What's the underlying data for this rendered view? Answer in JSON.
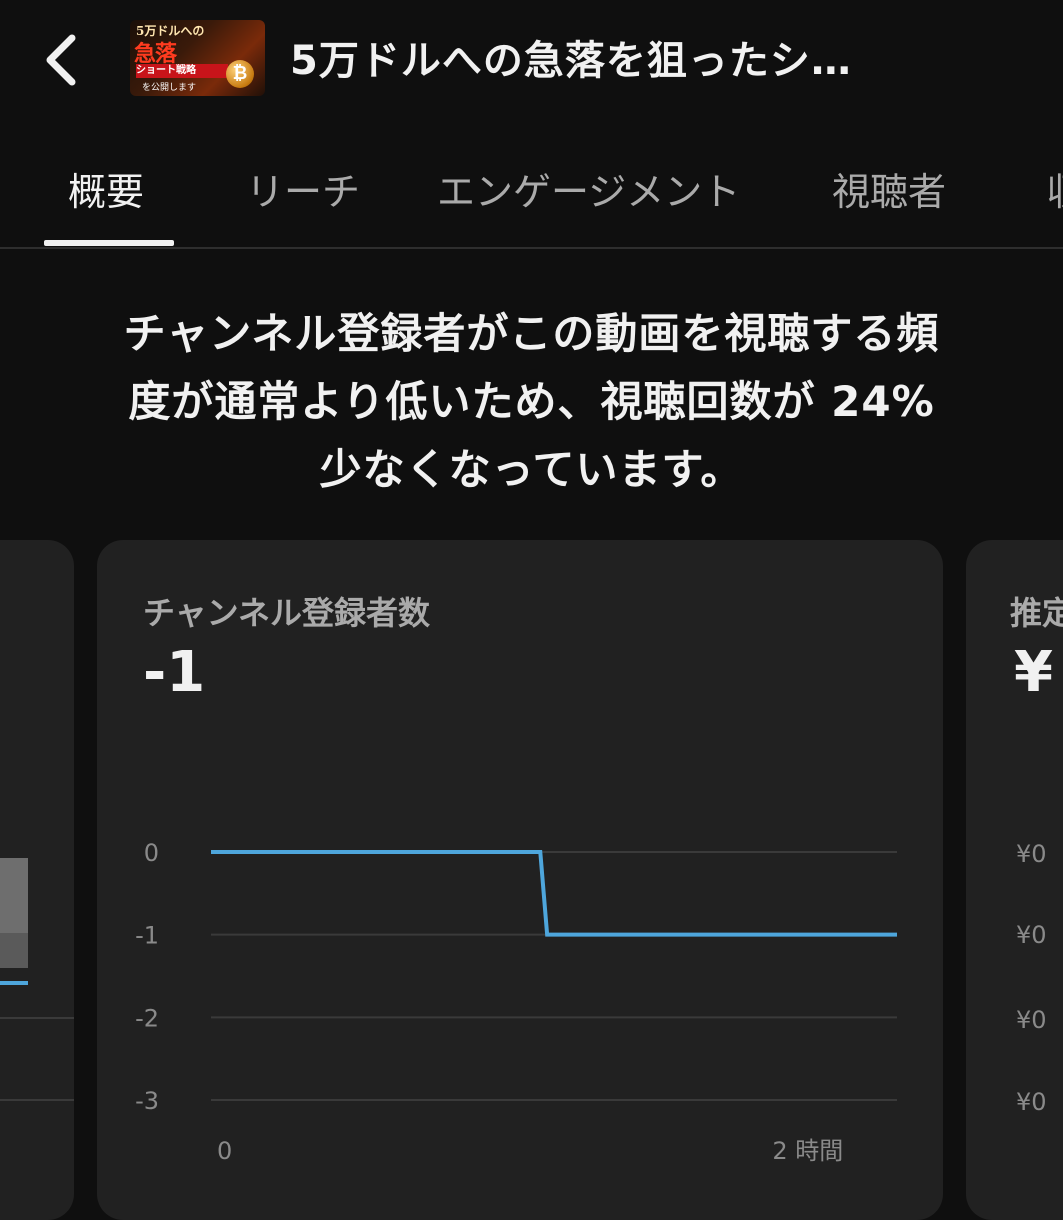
{
  "header": {
    "title": "5万ドルへの急落を狙ったシ…",
    "thumbnail": {
      "line1": "5万ドルへの",
      "line2": "急落",
      "line3": "ショート戦略",
      "line4": "を公開します",
      "coin": "₿"
    }
  },
  "tabs": [
    {
      "label": "概要",
      "active": true
    },
    {
      "label": "リーチ"
    },
    {
      "label": "エンゲージメント"
    },
    {
      "label": "視聴者"
    },
    {
      "label": "収"
    }
  ],
  "headline": {
    "line1": "チャンネル登録者がこの動画を視聴する頻",
    "line2": "度が通常より低いため、視聴回数が 24%",
    "line3": "少なくなっています。"
  },
  "main_card": {
    "label": "チャンネル登録者数",
    "value": "-1"
  },
  "right_card": {
    "label": "推定",
    "value": "¥",
    "ticks": [
      "¥0",
      "¥0",
      "¥0",
      "¥0"
    ]
  },
  "colors": {
    "accent_line": "#4ea6dc",
    "background": "#0f0f0f",
    "card": "#212121"
  },
  "chart_data": {
    "type": "line",
    "x_tick_labels": [
      "0",
      "2 時間"
    ],
    "y_ticks": [
      0,
      -1,
      -2,
      -3
    ],
    "ylim": [
      -3,
      0
    ],
    "series": [
      {
        "points": [
          [
            0,
            0
          ],
          [
            0.48,
            0
          ],
          [
            0.49,
            -1
          ],
          [
            1,
            -1
          ]
        ]
      }
    ]
  }
}
